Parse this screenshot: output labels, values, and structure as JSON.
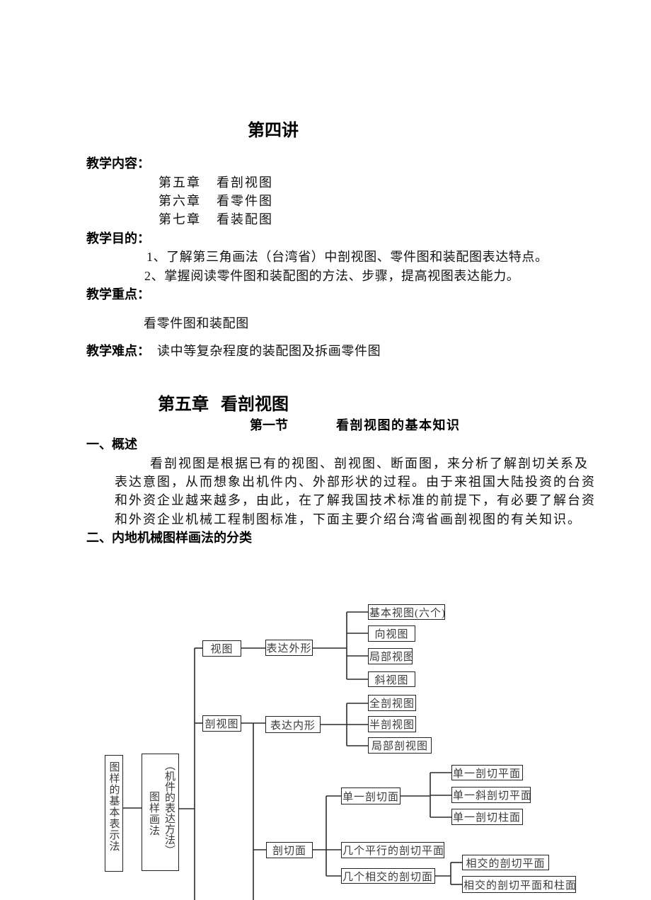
{
  "lecture_title": "第四讲",
  "teaching_content": {
    "label": "教学内容：",
    "items": [
      {
        "chapter": "第五章",
        "title": "看剖视图"
      },
      {
        "chapter": "第六章",
        "title": "看零件图"
      },
      {
        "chapter": "第七章",
        "title": "看装配图"
      }
    ]
  },
  "teaching_goals": {
    "label": "教学目的：",
    "items": [
      "1、了解第三角画法（台湾省）中剖视图、零件图和装配图表达特点。",
      "2、掌握阅读零件图和装配图的方法、步骤，提高视图表达能力。"
    ]
  },
  "teaching_focus": {
    "label": "教学重点：",
    "text": "看零件图和装配图"
  },
  "teaching_difficulty": {
    "label": "教学难点：",
    "text": "读中等复杂程度的装配图及拆画零件图"
  },
  "chapter_heading": {
    "chapter": "第五章",
    "title": "看剖视图"
  },
  "section": {
    "number": "第一节",
    "title": "看剖视图的基本知识"
  },
  "overview": {
    "heading": "一、概述",
    "lines": [
      "看剖视图是根据已有的视图、剖视图、断面图，来分析了解剖切关系及",
      "表达意图，从而想象出机件内、外部形状的过程。由于来祖国大陆投资的台资",
      "和外资企业越来越多，由此，在了解我国技术标准的前提下，有必要了解台资",
      "和外资企业机械工程制图标准，下面主要介绍台湾省画剖视图的有关知识。"
    ]
  },
  "classification_heading": "二、内地机械图样画法的分类",
  "diagram": {
    "root": "图样的基本表示法",
    "method": {
      "label": "图样画法",
      "note": "（机件的表达方法）"
    },
    "views": {
      "label": "视图",
      "purpose": "表达外形",
      "types": [
        "基本视图(六个)",
        "向视图",
        "局部视图",
        "斜视图"
      ]
    },
    "sectional_views": {
      "label": "剖视图",
      "purpose": "表达内形",
      "types": [
        "全剖视图",
        "半剖视图",
        "局部剖视图"
      ]
    },
    "cutting_planes": {
      "label": "剖切面",
      "single": {
        "label": "单一剖切面",
        "types": [
          "单一剖切平面",
          "单一斜剖切平面",
          "单一剖切柱面"
        ]
      },
      "parallel": "几个平行的剖切平面",
      "intersecting": {
        "label": "几个相交的剖切面",
        "types": [
          "相交的剖切平面",
          "相交的剖切平面和柱面"
        ]
      }
    }
  }
}
